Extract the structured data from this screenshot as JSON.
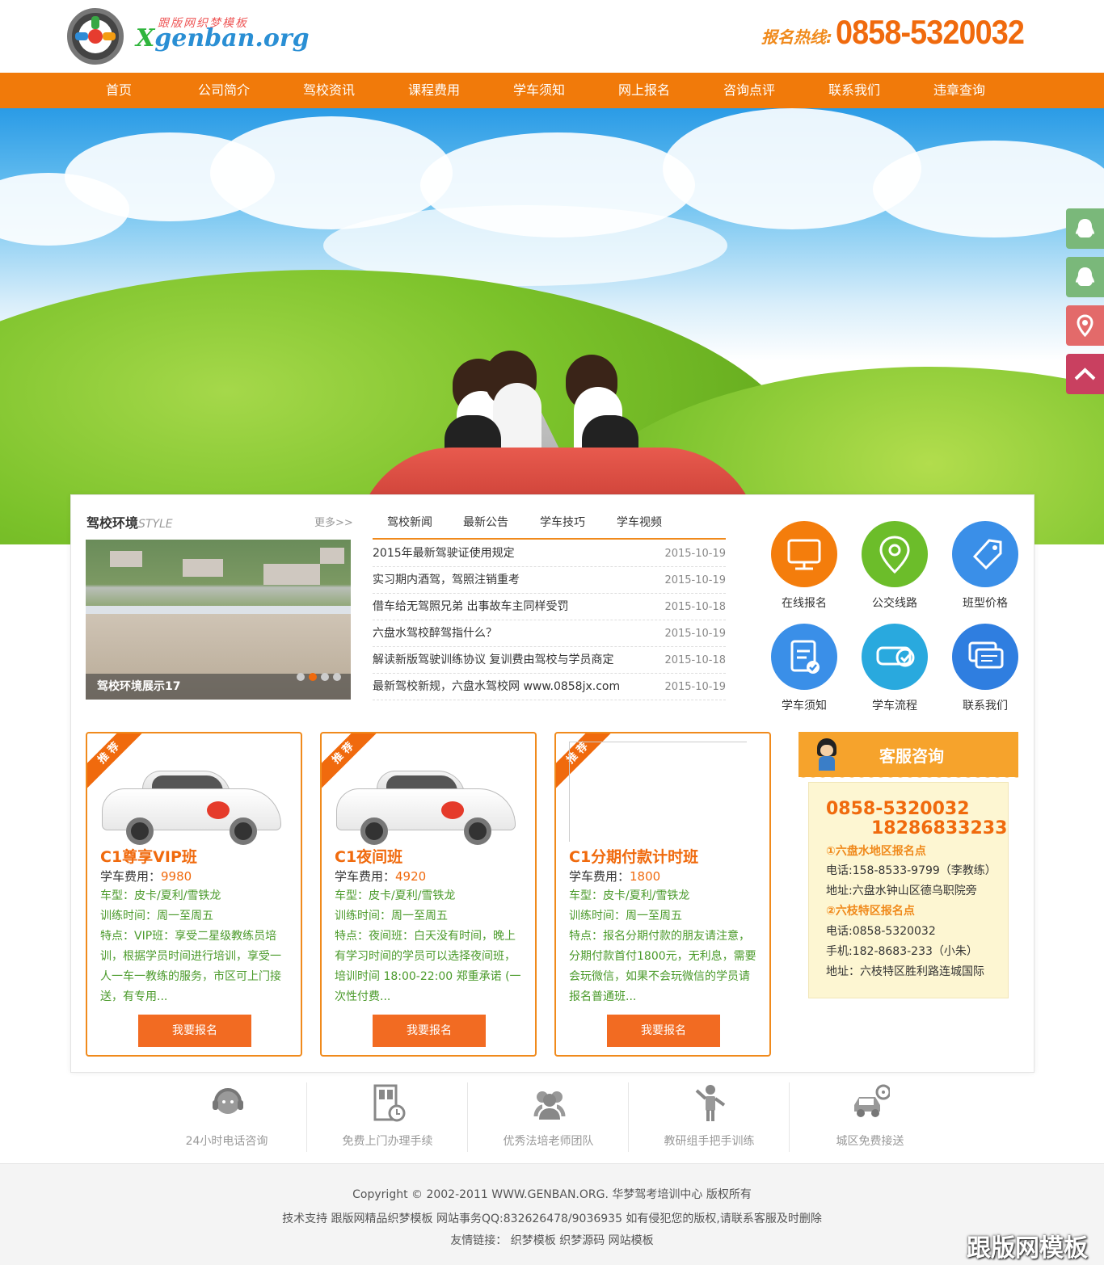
{
  "header": {
    "logo_tagline": "跟版网织梦模板",
    "logo_text_x": "X",
    "logo_text": "genban.org",
    "hotline_label": "报名热线:",
    "hotline_number": "0858-5320032"
  },
  "nav": {
    "items": [
      {
        "label": "首页"
      },
      {
        "label": "公司简介"
      },
      {
        "label": "驾校资讯"
      },
      {
        "label": "课程费用"
      },
      {
        "label": "学车须知"
      },
      {
        "label": "网上报名"
      },
      {
        "label": "咨询点评"
      },
      {
        "label": "联系我们"
      },
      {
        "label": "违章查询"
      }
    ]
  },
  "environment": {
    "title": "驾校环境",
    "title_en": "STYLE",
    "more": "更多>>",
    "caption": "驾校环境展示17"
  },
  "news": {
    "tabs": [
      "驾校新闻",
      "最新公告",
      "学车技巧",
      "学车视频"
    ],
    "items": [
      {
        "title": "2015年最新驾驶证使用规定",
        "date": "2015-10-19"
      },
      {
        "title": "实习期内酒驾，驾照注销重考",
        "date": "2015-10-19"
      },
      {
        "title": "借车给无驾照兄弟 出事故车主同样受罚",
        "date": "2015-10-18"
      },
      {
        "title": "六盘水驾校醉驾指什么？",
        "date": "2015-10-19"
      },
      {
        "title": "解读新版驾驶训练协议 复训费由驾校与学员商定",
        "date": "2015-10-18"
      },
      {
        "title": "最新驾校新规，六盘水驾校网 www.0858jx.com",
        "date": "2015-10-19"
      }
    ]
  },
  "quick_links": [
    {
      "label": "在线报名",
      "icon": "monitor-icon",
      "color": "#f47d0c"
    },
    {
      "label": "公交线路",
      "icon": "location-pin-icon",
      "color": "#6cbd2a"
    },
    {
      "label": "班型价格",
      "icon": "price-tag-icon",
      "color": "#3a8fe8"
    },
    {
      "label": "学车须知",
      "icon": "clipboard-check-icon",
      "color": "#3a8fe8"
    },
    {
      "label": "学车流程",
      "icon": "car-check-icon",
      "color": "#29a9de"
    },
    {
      "label": "联系我们",
      "icon": "chat-bubbles-icon",
      "color": "#2f7ee0"
    }
  ],
  "courses": [
    {
      "ribbon": "推 荐",
      "title": "C1尊享VIP班",
      "fee_label": "学车费用：",
      "fee": "9980",
      "car_type": "车型：皮卡/夏利/雪铁龙",
      "train_time": "训练时间：周一至周五",
      "features": "特点：VIP班：享受二星级教练员培训，根据学员时间进行培训，享受一人一车一教练的服务，市区可上门接送，有专用...",
      "button": "我要报名"
    },
    {
      "ribbon": "推 荐",
      "title": "C1夜间班",
      "fee_label": "学车费用：",
      "fee": "4920",
      "car_type": "车型：皮卡/夏利/雪铁龙",
      "train_time": "训练时间：周一至周五",
      "features": "特点：夜间班：白天没有时间，晚上有学习时间的学员可以选择夜间班，培训时间 18:00-22:00 郑重承诺 (一次性付费...",
      "button": "我要报名"
    },
    {
      "ribbon": "推 荐",
      "title": "C1分期付款计时班",
      "fee_label": "学车费用：",
      "fee": "1800",
      "car_type": "车型：皮卡/夏利/雪铁龙",
      "train_time": "训练时间：周一至周五",
      "features": "特点：报名分期付款的朋友请注意，分期付款首付1800元，无利息，需要会玩微信，如果不会玩微信的学员请报名普通班...",
      "button": "我要报名"
    }
  ],
  "service": {
    "title": "客服咨询",
    "phone1": "0858-5320032",
    "phone2": "18286833233",
    "site1_title": "①六盘水地区报名点",
    "site1_phone": "电话:158-8533-9799（李教练）",
    "site1_address": "地址:六盘水钟山区德乌职院旁",
    "site2_title": "②六枝特区报名点",
    "site2_phone": "电话:0858-5320032",
    "site2_mobile": "手机:182-8683-233（小朱）",
    "site2_address": "地址：六枝特区胜利路连城国际"
  },
  "features": [
    {
      "label": "24小时电话咨询",
      "icon": "headset-support-icon"
    },
    {
      "label": "免费上门办理手续",
      "icon": "door-clock-icon"
    },
    {
      "label": "优秀法培老师团队",
      "icon": "team-icon"
    },
    {
      "label": "教研组手把手训练",
      "icon": "instructor-icon"
    },
    {
      "label": "城区免费接送",
      "icon": "car-steering-icon"
    }
  ],
  "footer": {
    "copyright": "Copyright © 2002-2011 WWW.GENBAN.ORG. 华梦驾考培训中心 版权所有",
    "support": "技术支持 跟版网精品织梦模板 网站事务QQ:832626478/9036935 如有侵犯您的版权,请联系客服及时删除",
    "links": "友情链接： 织梦模板 织梦源码 网站模板",
    "watermark": "跟版网模板"
  },
  "side_tools": [
    {
      "icon": "qq-icon",
      "color": "#7ab87a"
    },
    {
      "icon": "qq-icon",
      "color": "#7ab87a"
    },
    {
      "icon": "map-pin-icon",
      "color": "#e36a6a"
    },
    {
      "icon": "back-to-top-icon",
      "color": "#c94060"
    }
  ]
}
